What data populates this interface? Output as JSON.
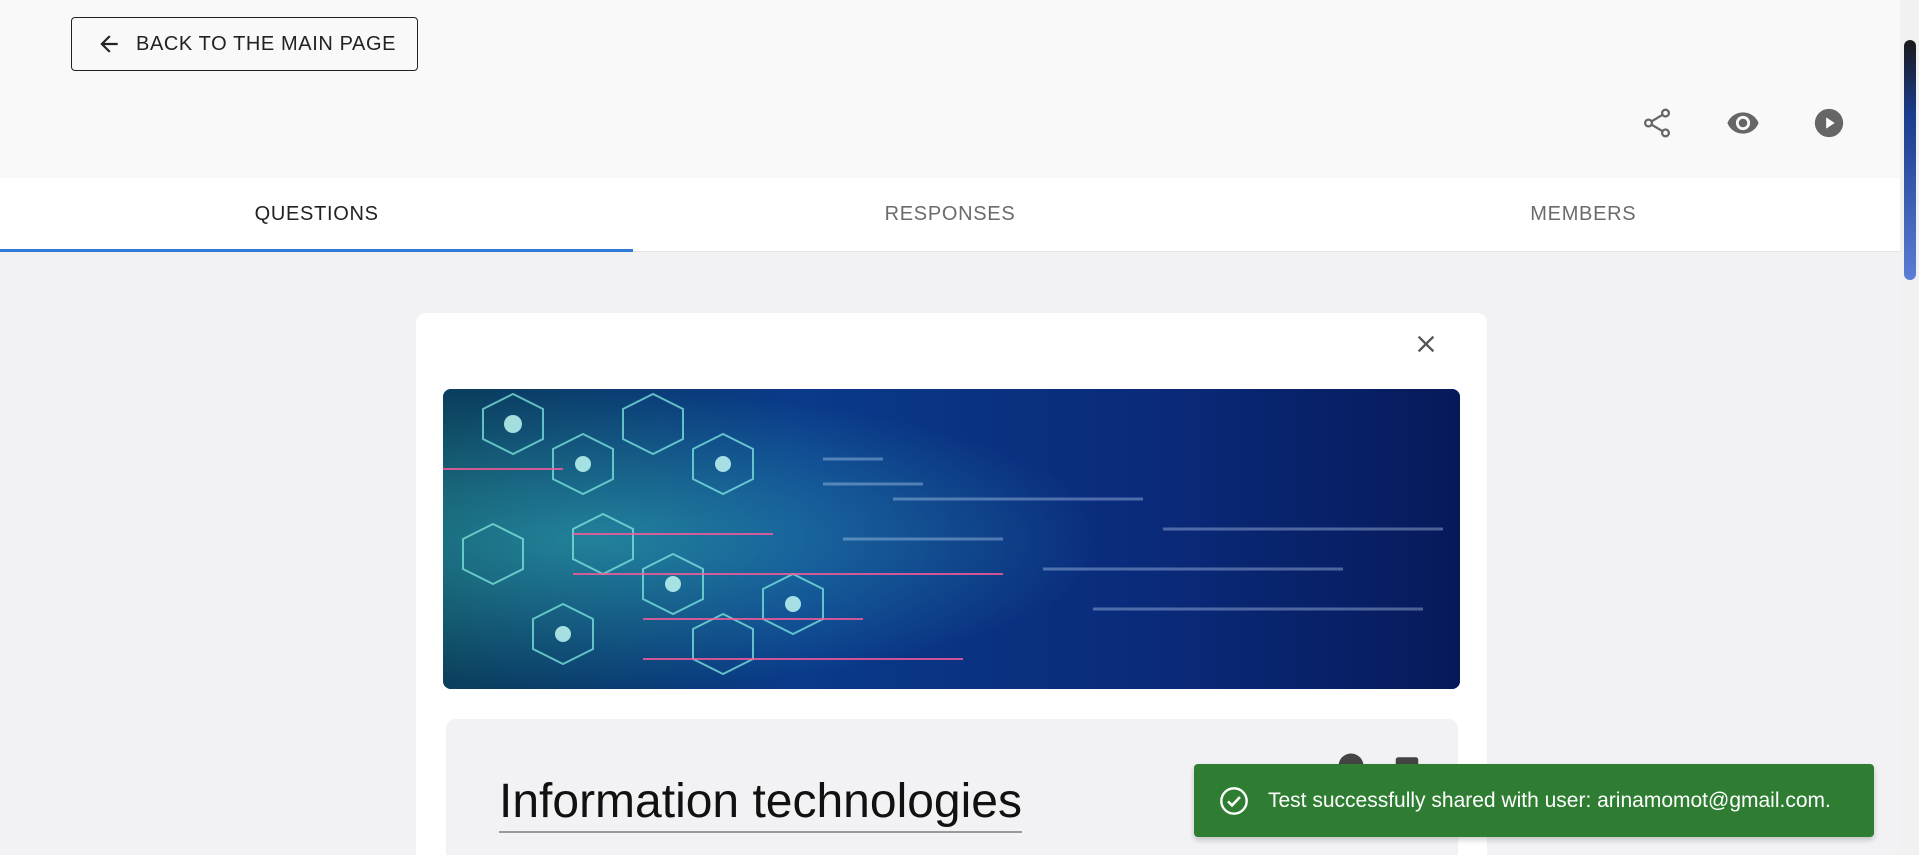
{
  "header": {
    "back_label": "BACK TO THE MAIN PAGE",
    "actions": [
      {
        "icon": "share-icon"
      },
      {
        "icon": "eye-icon"
      },
      {
        "icon": "play-circle-icon"
      }
    ]
  },
  "tabs": [
    {
      "label": "QUESTIONS",
      "active": true
    },
    {
      "label": "RESPONSES",
      "active": false
    },
    {
      "label": "MEMBERS",
      "active": false
    }
  ],
  "card": {
    "close_icon": "close-icon",
    "banner_icon": "tech-banner-image",
    "title": "Information technologies",
    "mini_icons": [
      "palette-icon",
      "image-icon"
    ]
  },
  "toast": {
    "icon": "check-circle-icon",
    "message": "Test successfully shared with user: arinamomot@gmail.com."
  },
  "colors": {
    "accent": "#2f7bd6",
    "toast_bg": "#2e7d32",
    "page_bg": "#f2f2f4"
  }
}
